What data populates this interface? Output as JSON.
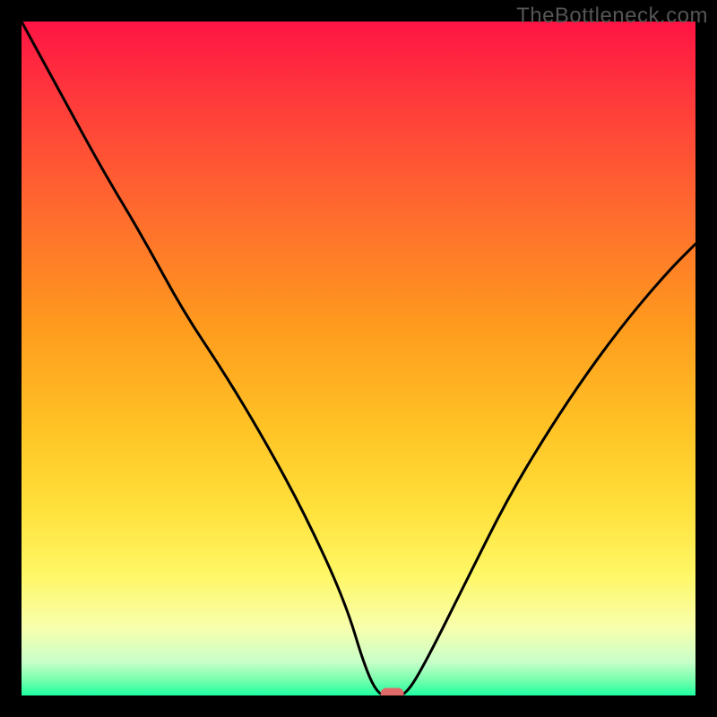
{
  "watermark": "TheBottleneck.com",
  "chart_data": {
    "type": "line",
    "title": "",
    "xlabel": "",
    "ylabel": "",
    "xlim": [
      0,
      100
    ],
    "ylim": [
      0,
      100
    ],
    "series": [
      {
        "name": "bottleneck-curve",
        "x": [
          0,
          6,
          12,
          18,
          24,
          30,
          36,
          42,
          48,
          51,
          53,
          55,
          57,
          60,
          66,
          72,
          78,
          84,
          90,
          96,
          100
        ],
        "y": [
          100,
          89,
          78,
          68,
          57,
          48,
          38,
          27,
          14,
          4,
          0,
          0,
          0,
          5,
          17,
          29,
          39,
          48,
          56,
          63,
          67
        ]
      }
    ],
    "marker": {
      "name": "optimum-point",
      "x": 55,
      "y": 0,
      "color": "#e06a6a"
    },
    "gradient_stops": [
      {
        "offset": 0.0,
        "color": "#ff1444"
      },
      {
        "offset": 0.12,
        "color": "#ff3b3b"
      },
      {
        "offset": 0.28,
        "color": "#ff6a2e"
      },
      {
        "offset": 0.45,
        "color": "#ff9a1e"
      },
      {
        "offset": 0.6,
        "color": "#ffc225"
      },
      {
        "offset": 0.72,
        "color": "#ffe03a"
      },
      {
        "offset": 0.82,
        "color": "#fff765"
      },
      {
        "offset": 0.9,
        "color": "#f7ffad"
      },
      {
        "offset": 0.95,
        "color": "#c9ffc9"
      },
      {
        "offset": 0.975,
        "color": "#7effb0"
      },
      {
        "offset": 1.0,
        "color": "#1effa0"
      }
    ]
  }
}
